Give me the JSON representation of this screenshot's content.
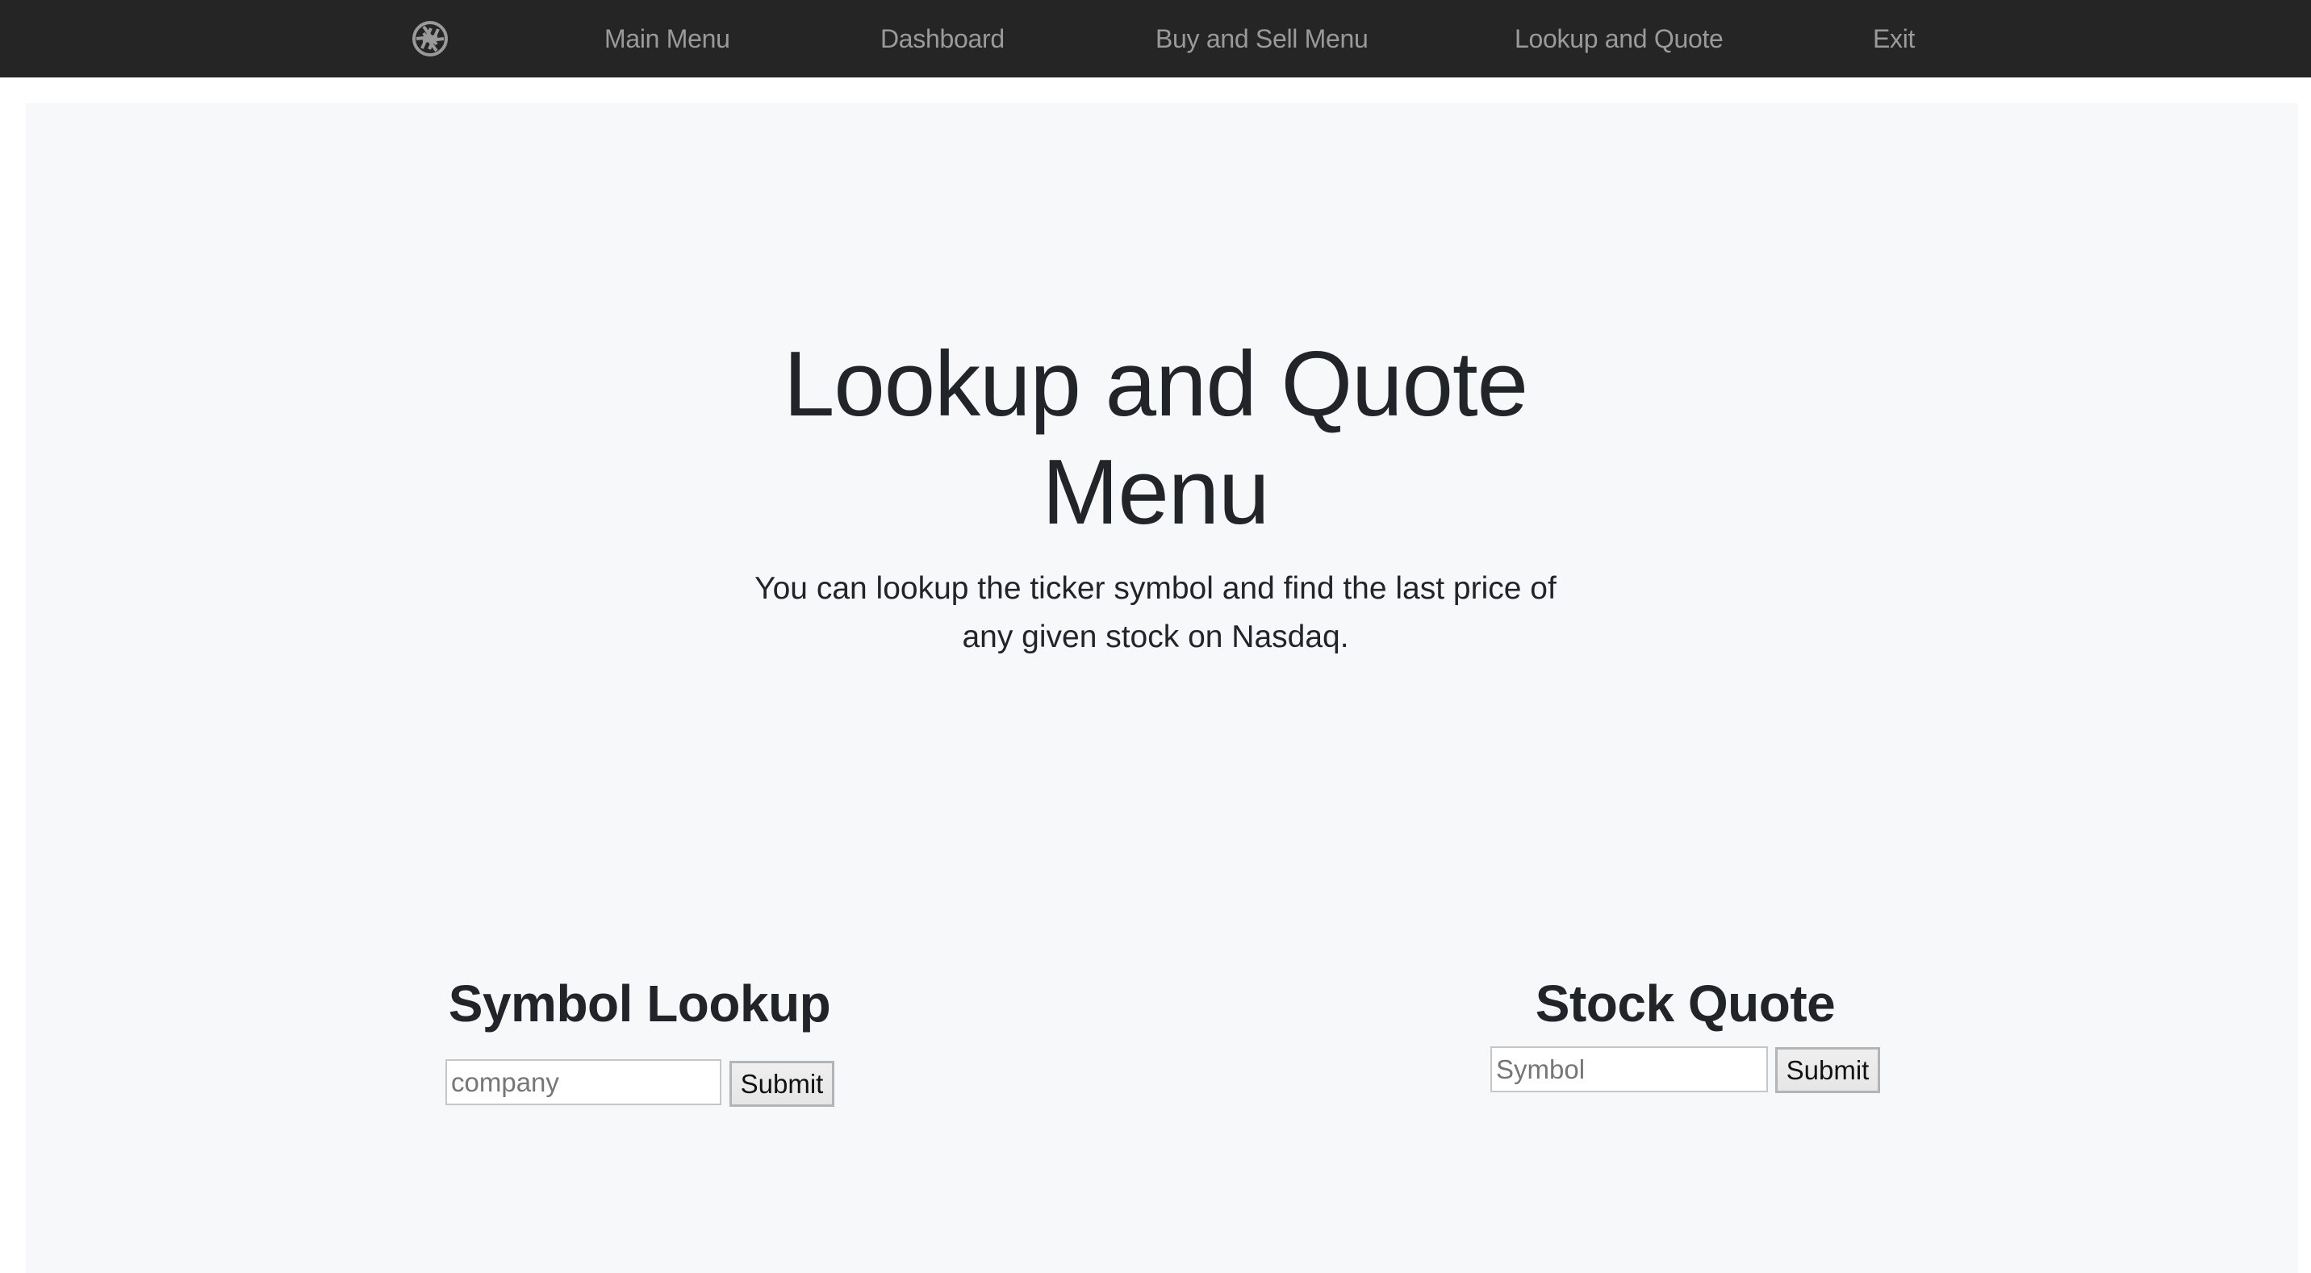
{
  "navbar": {
    "logo_icon": "aperture-icon",
    "links": [
      {
        "label": "Main Menu"
      },
      {
        "label": "Dashboard"
      },
      {
        "label": "Buy and Sell Menu"
      },
      {
        "label": "Lookup and Quote"
      },
      {
        "label": "Exit"
      }
    ]
  },
  "hero": {
    "title": "Lookup and Quote Menu",
    "lead": "You can lookup the ticker symbol and find the last price of any given stock on Nasdaq."
  },
  "symbol_lookup": {
    "title": "Symbol Lookup",
    "input_value": "",
    "input_placeholder": "company",
    "submit_label": "Submit"
  },
  "stock_quote": {
    "title": "Stock Quote",
    "input_value": "",
    "input_placeholder": "Symbol",
    "submit_label": "Submit"
  },
  "colors": {
    "navbar_bg": "#252525",
    "nav_text": "#9a9a9a",
    "panel_bg": "#f7f8fa",
    "text": "#212529"
  }
}
